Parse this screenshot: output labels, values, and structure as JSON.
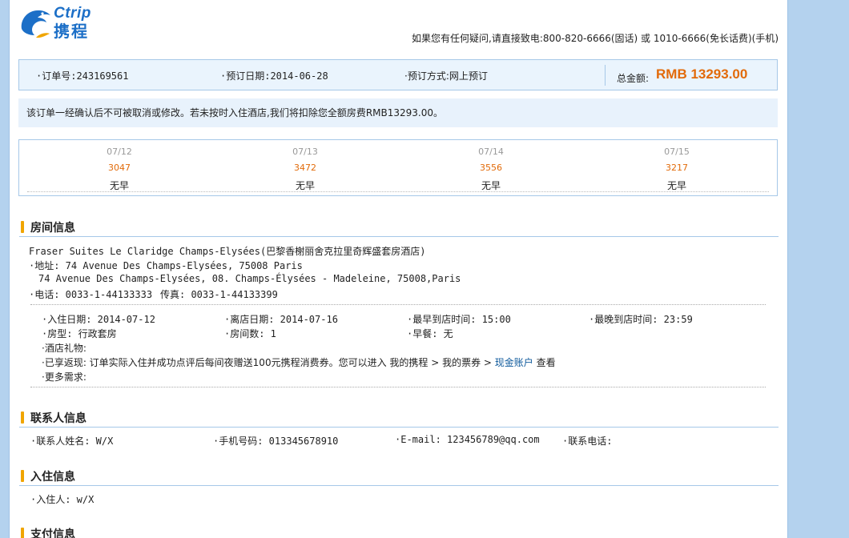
{
  "header": {
    "logo_word": "Ctrip",
    "logo_cn": "携程",
    "hotline": "如果您有任何疑问,请直接致电:800-820-6666(固话) 或 1010-6666(免长话费)(手机)"
  },
  "order": {
    "order_no": "·订单号:243169561",
    "order_date": "·预订日期:2014-06-28",
    "order_method": "·预订方式:网上预订",
    "total_label": "总金额:",
    "total_value": "RMB 13293.00"
  },
  "notice": "该订单一经确认后不可被取消或修改。若未按时入住酒店,我们将扣除您全额房费RMB13293.00。",
  "daily_prices": [
    {
      "date": "07/12",
      "price": "3047",
      "meal": "无早"
    },
    {
      "date": "07/13",
      "price": "3472",
      "meal": "无早"
    },
    {
      "date": "07/14",
      "price": "3556",
      "meal": "无早"
    },
    {
      "date": "07/15",
      "price": "3217",
      "meal": "无早"
    }
  ],
  "room": {
    "title": "房间信息",
    "hotel_name": "Fraser Suites Le Claridge Champs-Elysées(巴黎香榭丽舍克拉里奇辉盛套房酒店)",
    "address": "·地址: 74 Avenue Des Champs-Elysées, 75008 Paris",
    "address2": "74 Avenue Des Champs-Elysées, 08. Champs-Élysées - Madeleine, 75008,Paris",
    "phone": "·电话: 0033-1-44133333",
    "fax": "传真: 0033-1-44133399",
    "checkin": "·入住日期: 2014-07-12",
    "checkout": "·离店日期: 2014-07-16",
    "earliest": "·最早到店时间: 15:00",
    "latest": "·最晚到店时间: 23:59",
    "room_type": "·房型: 行政套房",
    "room_count": "·房间数: 1",
    "breakfast": "·早餐: 无",
    "gift": "·酒店礼物:",
    "cashback_prefix": "·已享返现: 订单实际入住并成功点评后每间夜赠送100元携程消费券。您可以进入 我的携程 > 我的票券 > ",
    "cashback_link": "现金账户",
    "cashback_suffix": " 查看",
    "more": "·更多需求:"
  },
  "contact": {
    "title": "联系人信息",
    "name": "·联系人姓名: W/X",
    "mobile": "·手机号码: 013345678910",
    "email": "·E-mail: 123456789@qq.com",
    "tel": "·联系电话:"
  },
  "guest": {
    "title": "入住信息",
    "name": "·入住人: w/X"
  },
  "payment": {
    "title": "支付信息"
  },
  "colors": {
    "accent_orange": "#e26b0a",
    "brand_blue": "#1c6fc7",
    "section_marker": "#f0a500",
    "page_background": "#b4d2ee"
  }
}
